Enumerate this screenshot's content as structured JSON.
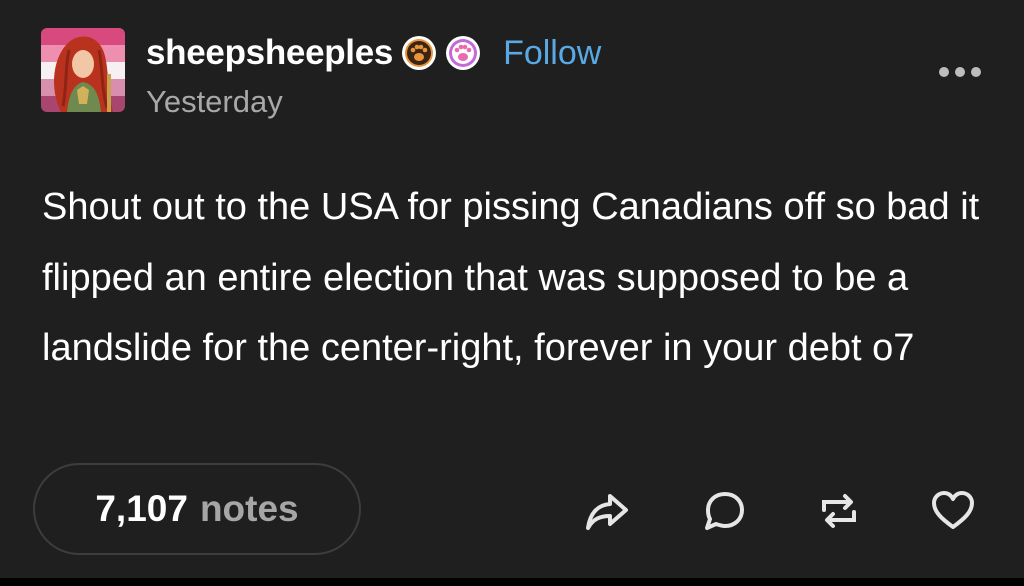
{
  "post": {
    "author": {
      "username": "sheepsheeples",
      "badges": [
        {
          "icon": "paw-badge-icon",
          "color": "#e8943a"
        },
        {
          "icon": "paw-badge-icon",
          "color": "#c46ad8"
        }
      ]
    },
    "follow_label": "Follow",
    "timestamp": "Yesterday",
    "more_icon": "ellipsis-icon",
    "body_text": "Shout out to the USA for pissing Canadians off so bad it flipped an entire election that was supposed to be a landslide for the center-right, forever in your debt o7"
  },
  "footer": {
    "notes_count": "7,107",
    "notes_label": "notes",
    "actions": [
      {
        "icon": "share-icon"
      },
      {
        "icon": "reply-icon"
      },
      {
        "icon": "reblog-icon"
      },
      {
        "icon": "like-icon"
      }
    ]
  },
  "colors": {
    "background": "#1f1f1f",
    "accent_link": "#58a9e4",
    "muted_text": "#a8a8a8"
  }
}
